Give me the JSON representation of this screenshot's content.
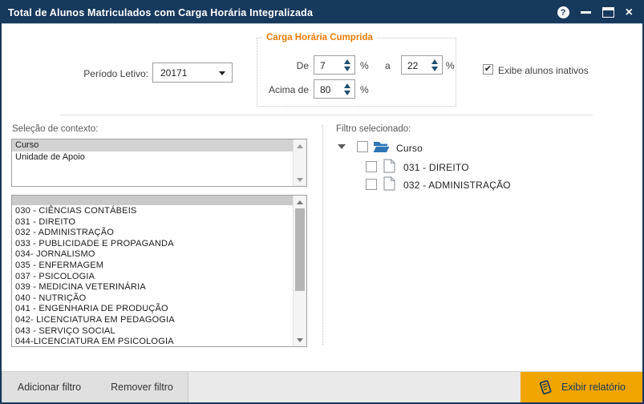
{
  "colors": {
    "titlebar": "#17395C",
    "legend_orange": "#EE7B08",
    "report_button": "#F0A500"
  },
  "titlebar": {
    "title": "Total de Alunos Matriculados com Carga Horária Integralizada",
    "help_glyph": "?",
    "close_glyph": "×"
  },
  "periodo": {
    "label": "Período Letivo:",
    "value": "20171"
  },
  "carga": {
    "legend": "Carga Horária Cumprida",
    "de_label": "De",
    "de_value": "7",
    "a_label": "a",
    "a_value": "22",
    "acima_label": "Acima de",
    "acima_value": "80",
    "percent": "%"
  },
  "inativos": {
    "label": "Exibe alunos inativos",
    "checked": true,
    "check_glyph": "✔"
  },
  "contexto": {
    "label": "Seleção de contexto:",
    "options": [
      "Curso",
      "Unidade de Apoio"
    ],
    "selected": "Curso"
  },
  "courses": [
    "030 - CIÊNCIAS CONTÁBEIS",
    "031 - DIREITO",
    "032 - ADMINISTRAÇÃO",
    "033 - PUBLICIDADE E PROPAGANDA",
    "034- JORNALISMO",
    "035 - ENFERMAGEM",
    "037 - PSICOLOGIA",
    "039 - MEDICINA VETERINÁRIA",
    "040 - NUTRIÇÃO",
    "041 - ENGENHARIA DE PRODUÇÃO",
    "042- LICENCIATURA EM PEDAGOGIA",
    "043 - SERVIÇO SOCIAL",
    "044-LICENCIATURA EM PSICOLOGIA"
  ],
  "filtro": {
    "label": "Filtro selecionado:",
    "root": "Curso",
    "children": [
      "031 - DIREITO",
      "032 - ADMINISTRAÇÃO"
    ]
  },
  "footer": {
    "add_label": "Adicionar filtro",
    "remove_label": "Remover filtro",
    "report_label": "Exibir relatório"
  }
}
